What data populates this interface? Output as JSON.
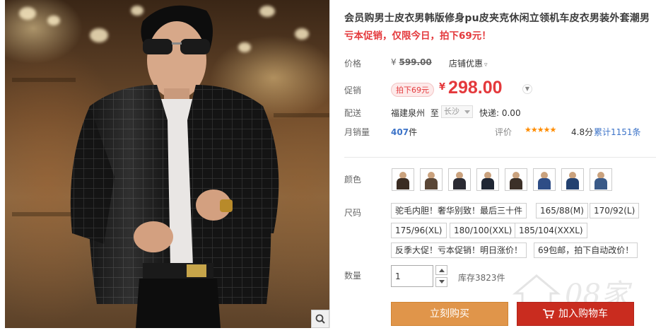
{
  "product": {
    "title": "会员购男士皮衣男韩版修身pu皮夹克休闲立领机车皮衣男装外套潮男",
    "promo": "亏本促销，仅限今日，拍下69元！"
  },
  "labels": {
    "price": "价格",
    "promo_price": "促销",
    "shipping": "配送",
    "monthly_sales": "月销量",
    "rating": "评价",
    "color": "颜色",
    "size": "尺码",
    "quantity": "数量"
  },
  "price": {
    "original": "599.00",
    "currency_symbol": "¥",
    "shop_discount": "店铺优惠",
    "tag": "拍下69元",
    "current": "298.00"
  },
  "shipping": {
    "from": "福建泉州",
    "to_word": "至",
    "destination": "长沙",
    "fee": "快递: 0.00"
  },
  "sales": {
    "count": "407",
    "unit": "件",
    "stars": "★★★★★",
    "score": "4.8分",
    "reviews": "累计1151条"
  },
  "colors": [
    {
      "jacket": "#3a2c22"
    },
    {
      "jacket": "#5a4636"
    },
    {
      "jacket": "#2b2b33"
    },
    {
      "jacket": "#1f2633"
    },
    {
      "jacket": "#3c3028"
    },
    {
      "jacket": "#2e4d86"
    },
    {
      "jacket": "#234170"
    },
    {
      "jacket": "#3a5a88"
    }
  ],
  "sizes": [
    "驼毛内胆！奢华别致！最后三十件",
    "165/88(M)",
    "170/92(L)",
    "175/96(XL)",
    "180/100(XXL)",
    "185/104(XXXL)",
    "反季大促！亏本促销！明日涨价！",
    "69包邮，拍下自动改价！"
  ],
  "quantity": {
    "value": "1",
    "stock": "库存3823件"
  },
  "actions": {
    "buy_now": "立刻购买",
    "add_to_cart": "加入购物车"
  },
  "watermark": {
    "text": "08家",
    "url": "www.jia08.com"
  },
  "theme": {
    "accent_red": "#e4393c",
    "buy_orange": "#e0954a",
    "cart_red": "#c92c1f",
    "link_blue": "#3c73c8",
    "star_orange": "#ff8c00"
  }
}
